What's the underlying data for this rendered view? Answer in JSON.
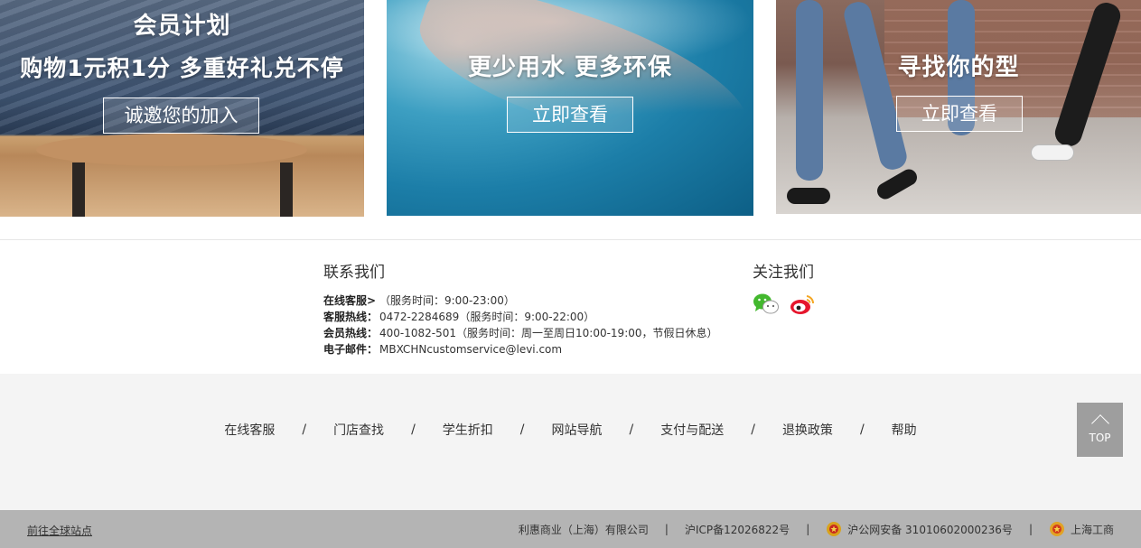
{
  "banners": [
    {
      "title_line1": "会员计划",
      "title_line2": "购物1元积1分 多重好礼兑不停",
      "button": "诚邀您的加入"
    },
    {
      "title_line1": "更少用水 更多环保",
      "button": "立即查看"
    },
    {
      "title_line1": "寻找你的型",
      "button": "立即查看"
    }
  ],
  "contact": {
    "title": "联系我们",
    "rows": [
      {
        "label": "在线客服>",
        "value": "（服务时间：9:00-23:00）"
      },
      {
        "label": "客服热线：",
        "value": "0472-2284689（服务时间：9:00-22:00）"
      },
      {
        "label": "会员热线：",
        "value": "400-1082-501（服务时间：周一至周日10:00-19:00，节假日休息）"
      },
      {
        "label": "电子邮件：",
        "value": "MBXCHNcustomservice@levi.com"
      }
    ]
  },
  "follow": {
    "title": "关注我们",
    "icons": [
      "wechat-icon",
      "weibo-icon"
    ]
  },
  "nav": {
    "links": [
      "在线客服",
      "门店查找",
      "学生折扣",
      "网站导航",
      "支付与配送",
      "退换政策",
      "帮助"
    ],
    "separator": "/"
  },
  "top_button": {
    "label": "TOP"
  },
  "bottom": {
    "global_link": "前往全球站点",
    "company": "利惠商业（上海）有限公司",
    "icp": "沪ICP备12026822号",
    "police": "沪公网安备 31010602000236号",
    "commerce": "上海工商",
    "divider": "|"
  },
  "colors": {
    "nav_band": "#f4f4f4",
    "bottom_bar": "#b4b4b4",
    "top_button": "#9e9e9e",
    "wechat": "#43b82e",
    "weibo": "#e6162d"
  }
}
